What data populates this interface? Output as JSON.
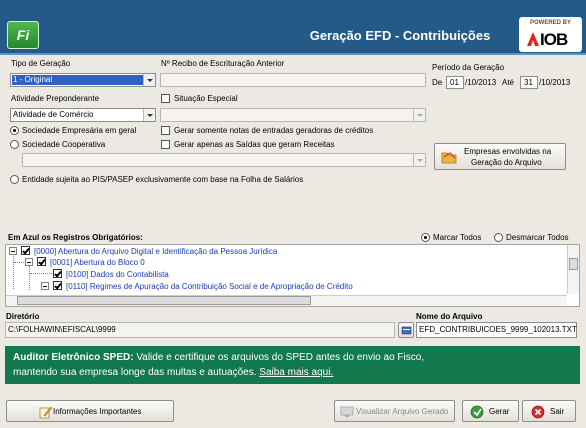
{
  "header": {
    "logo_text": "Fi",
    "title": "Geração EFD - Contribuições",
    "powered_by": "POWERED BY",
    "iob": "IOB"
  },
  "form": {
    "tipo_geracao_label": "Tipo de Geração",
    "tipo_geracao_value": "1 - Original",
    "recibo_label": "Nº Recibo de Escrituração Anterior",
    "recibo_value": "",
    "periodo_label": "Período da Geração",
    "periodo_de_label": "De",
    "periodo_de_day": "01",
    "periodo_de_rest": "/10/2013",
    "periodo_ate_label": "Até",
    "periodo_ate_day": "31",
    "periodo_ate_rest": "/10/2013",
    "atividade_label": "Atividade Preponderante",
    "atividade_value": "Atividade de Comércio",
    "situacao_especial_label": "Situação Especial",
    "radio_empresarial": "Sociedade Empresária em geral",
    "radio_cooperativa": "Sociedade Cooperativa",
    "check_notas_entradas": "Gerar somente notas de entradas geradoras de créditos",
    "check_saidas_receitas": "Gerar apenas as Saídas que geram Receitas",
    "empresas_button_line1": "Empresas envolvidas na",
    "empresas_button_line2": "Geração do Arquivo",
    "radio_pis_pasep": "Entidade sujeita ao PIS/PASEP exclusivamente com base na Folha de Salários"
  },
  "registros": {
    "label": "Em Azul os Registros Obrigatórios:",
    "marcar_todos": "Marcar Todos",
    "desmarcar_todos": "Desmarcar Todos",
    "tree": [
      "[0000] Abertura do Arquivo Digital e Identificação da Pessoa Jurídica",
      "[0001] Abertura do Bloco 0",
      "[0100] Dados do Contabilista",
      "[0110] Regimes de Apuração da Contribuição Social e de Apropriação de Crédito"
    ]
  },
  "arquivo": {
    "diretorio_label": "Diretório",
    "diretorio_value": "C:\\FOLHAWIN\\EFISCAL\\9999",
    "nome_label": "Nome do Arquivo",
    "nome_value": "EFD_CONTRIBUICOES_9999_102013.TXT"
  },
  "banner": {
    "bold": "Auditor Eletrônico SPED:",
    "text1": " Valide e certifique os arquivos do SPED antes do envio ao Fisco,",
    "text2": "mantendo sua empresa longe das multas e autuações.",
    "link": "Saiba mais aqui."
  },
  "buttons": {
    "informacoes": "Informações Importantes",
    "visualizar": "Visualizar Arquivo Gerado",
    "gerar": "Gerar",
    "sair": "Sair"
  },
  "colors": {
    "header": "#235a87",
    "banner": "#12794e",
    "tree_link": "#1a3cb4",
    "combo_selected": "#2f61c1"
  }
}
